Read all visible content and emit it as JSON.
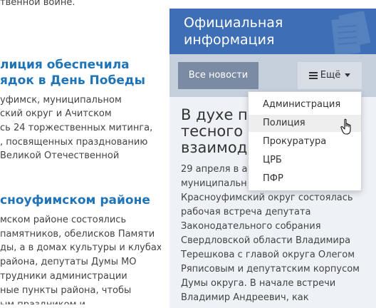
{
  "left_column": {
    "top_fragment": "твенной войне.",
    "news1": {
      "title_lines": [
        "лиция обеспечила",
        "ядок в День Победы"
      ],
      "text_lines": [
        "уфимск, муниципальном",
        "ский округ и Ачитском",
        "сь 24 торжественных митинга,",
        ", посвященных празднованию",
        "Великой Отечественной"
      ]
    },
    "news2": {
      "title_lines": [
        "сноуфимском районе"
      ],
      "text_lines": [
        "мском районе состоялись",
        "памятников, обелисков Памяти",
        "ды, а в домах культуры и клубах",
        "района, депутаты Думы МО",
        "трудники администрации",
        "ные пункты района, чтобы",
        "ым праздником и"
      ]
    }
  },
  "panel": {
    "title_lines": [
      "Официальная",
      "информация"
    ],
    "all_news_label": "Все новости",
    "more_label": "Ещё",
    "dropdown_items": [
      "Администрация",
      "Полиция",
      "Прокуратура",
      "ЦРБ",
      "ПФР"
    ],
    "hovered_item": "Полиция",
    "article": {
      "title_lines": [
        "В духе по",
        "тесного",
        "взаимоде"
      ],
      "body_lines": [
        "29 апреля в ад",
        "муниципальн",
        "Красноуфимский округ состоялась",
        "рабочая встреча депутата",
        "Законодательного собрания",
        "Свердловской области Владимира",
        "Терешкова с главой округа Олегом",
        "Ряписовым и депутатским корпусом",
        "Думы округа.  В начале встречи",
        "Владимир Андреевич, как"
      ]
    }
  },
  "colors": {
    "header_blue": "#3e6fb6",
    "link_blue": "#1f74b8",
    "button_gray": "#7a8ba3",
    "panel_bg": "#eef1f6"
  },
  "icons": [
    "hamburger-icon",
    "caret-down-icon",
    "document-stack-icon",
    "hand-cursor-icon"
  ]
}
